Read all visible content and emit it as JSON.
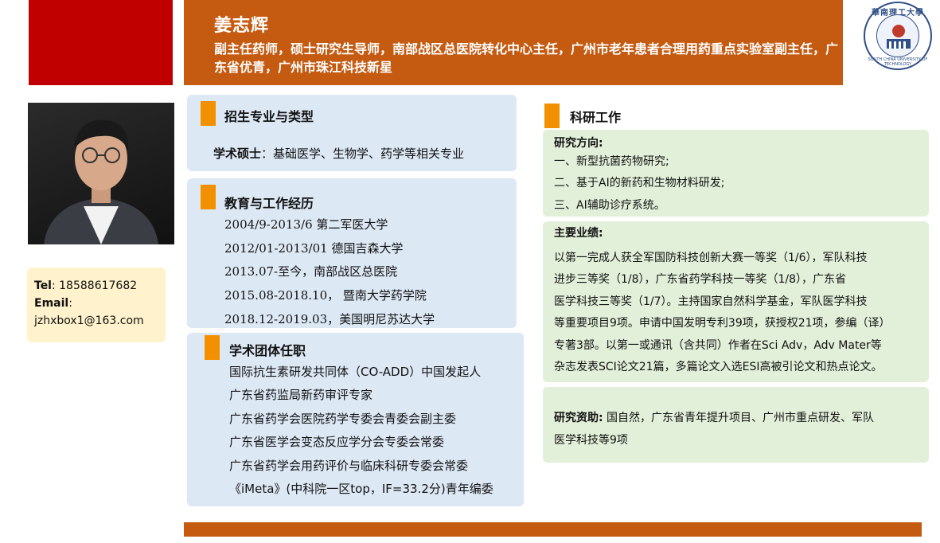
{
  "header": {
    "name": "姜志辉",
    "titles": "副主任药师，硕士研究生导师，南部战区总医院转化中心主任，广州市老年患者合理用药重点实验室副主任，广东省优青，广州市珠江科技新星",
    "bar_color": "#c55a11",
    "accent_color": "#c00000"
  },
  "logo": {
    "top_text": "華南理工大學",
    "bottom_text": "SOUTH CHINA UNIVERSITY OF TECHNOLOGY",
    "icon": "university-seal-icon"
  },
  "contact": {
    "tel_label": "Tel",
    "tel_value": ": 18588617682",
    "email_label": "Email",
    "email_value": "jzhxbox1@163.com"
  },
  "enrollment": {
    "title": "招生专业与类型",
    "label": "学术硕士",
    "text": "：基础医学、生物学、药学等相关专业"
  },
  "experience": {
    "title": "教育与工作经历",
    "items": [
      {
        "date": "2004/9-2013/6",
        "place": "第二军医大学"
      },
      {
        "date": "2012/01-2013/01",
        "place": "德国吉森大学"
      },
      {
        "date": "2013.07-至今，",
        "place": "南部战区总医院"
      },
      {
        "date": "2015.08-2018.10，",
        "place": "暨南大学药学院"
      },
      {
        "date": "2018.12-2019.03，",
        "place": "美国明尼苏达大学"
      }
    ]
  },
  "societies": {
    "title": "学术团体任职",
    "items": [
      "国际抗生素研发共同体（CO-ADD）中国发起人",
      "广东省药监局新药审评专家",
      "广东省药学会医院药学专委会青委会副主委",
      "广东省医学会变态反应学分会专委会常委",
      "广东省药学会用药评价与临床科研专委会常委",
      "《iMeta》(中科院一区top，IF=33.2分)青年编委"
    ]
  },
  "research": {
    "title": "科研工作",
    "directions_title": "研究方向:",
    "directions": [
      "一、新型抗菌药物研究;",
      "二、基于AI的新药和生物材料研发;",
      "三、AI辅助诊疗系统。"
    ],
    "achievements_title": "主要业绩:",
    "achievements_lines": [
      "以第一完成人获全军国防科技创新大赛一等奖（1/6），军队科技",
      "进步三等奖（1/8），广东省药学科技一等奖（1/8），广东省",
      "医学科技三等奖（1/7）。主持国家自然科学基金，军队医学科技",
      "等重要项目9项。申请中国发明专利39项，获授权21项，参编（译）",
      "专著3部。以第一或通讯（含共同）作者在Sci Adv，Adv Mater等",
      "杂志发表SCI论文21篇，多篇论文入选ESI高被引论文和热点论文。"
    ],
    "funding_label": "研究资助:",
    "funding_lines": [
      " 国自然，广东省青年提升项目、广州市重点研发、军队",
      "医学科技等9项"
    ]
  }
}
